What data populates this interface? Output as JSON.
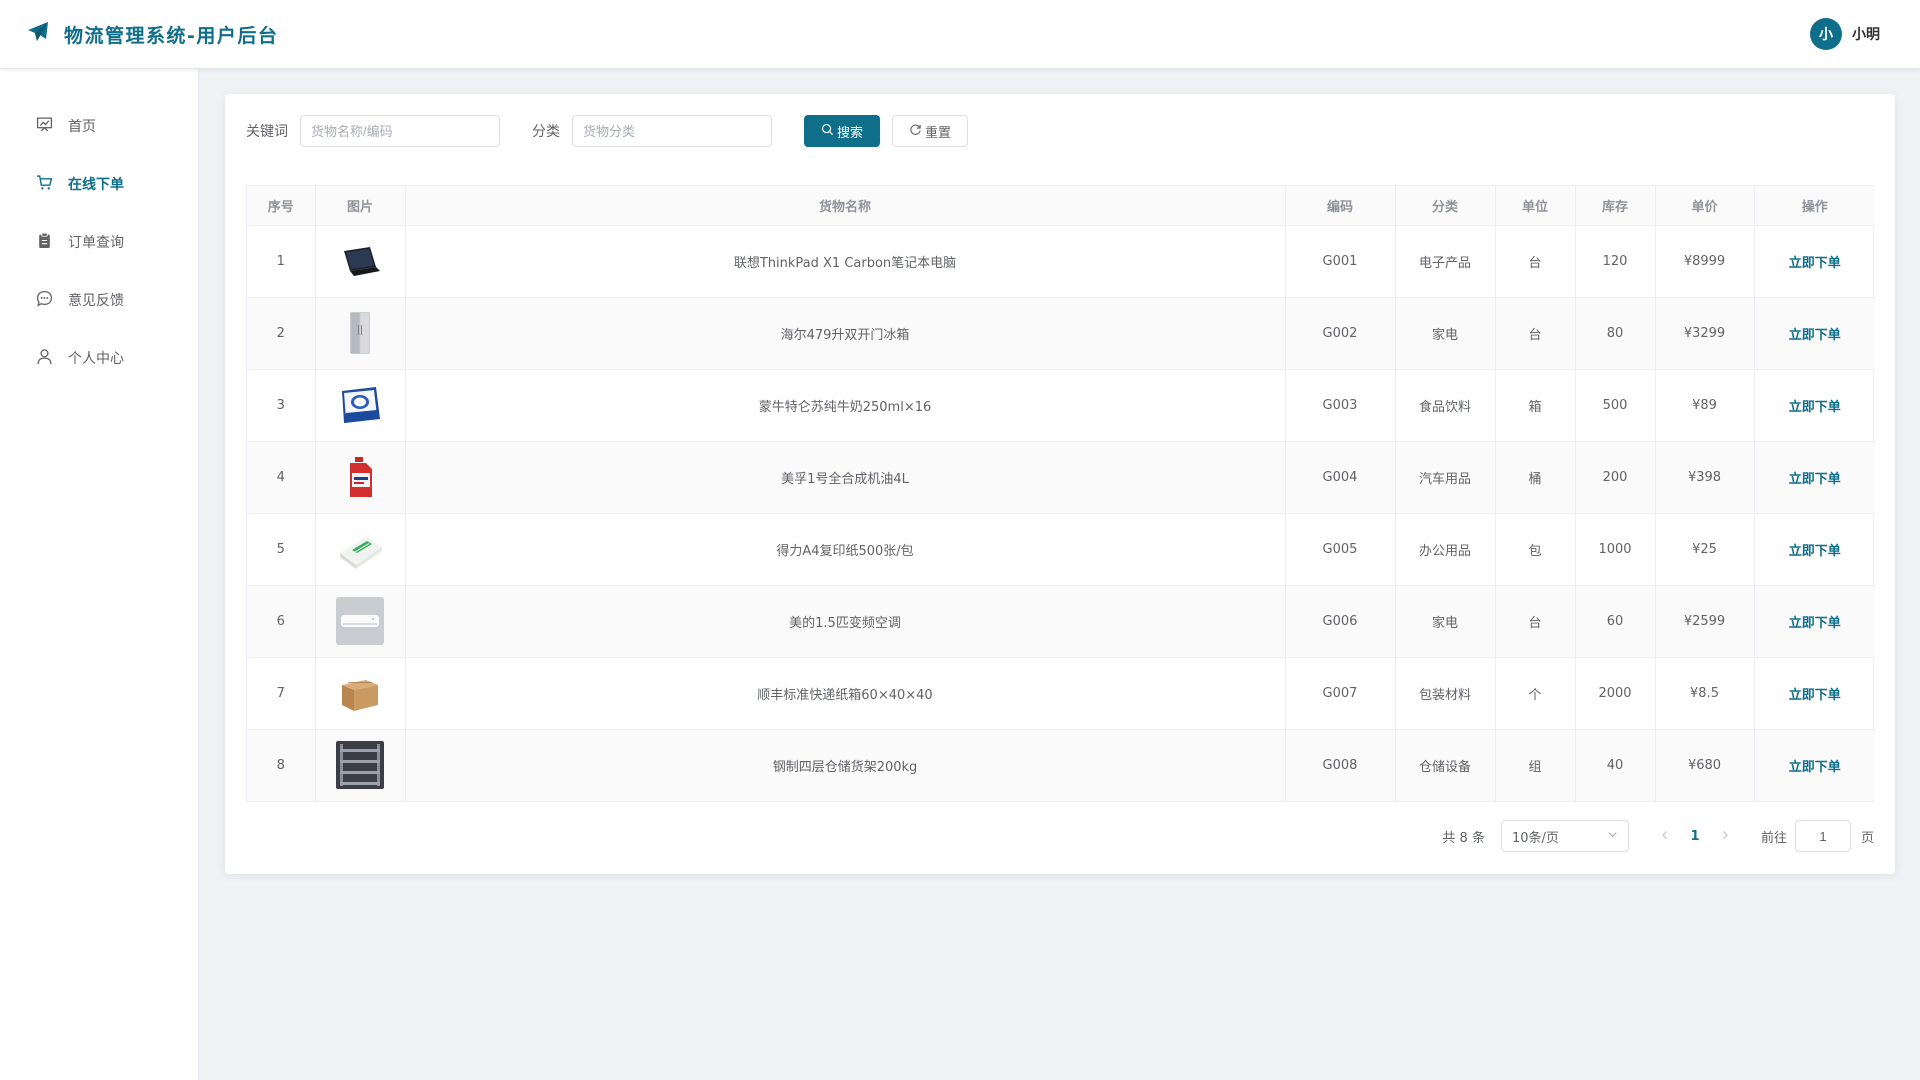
{
  "header": {
    "app_title": "物流管理系统-用户后台",
    "brand_color": "#0f6e8a",
    "logo_icon": "paper-plane-icon",
    "user": {
      "avatar_text": "小",
      "name": "小明"
    }
  },
  "sidebar": {
    "items": [
      {
        "label": "首页",
        "icon": "dashboard-icon",
        "active": false
      },
      {
        "label": "在线下单",
        "icon": "cart-icon",
        "active": true
      },
      {
        "label": "订单查询",
        "icon": "clipboard-icon",
        "active": false
      },
      {
        "label": "意见反馈",
        "icon": "chat-icon",
        "active": false
      },
      {
        "label": "个人中心",
        "icon": "user-icon",
        "active": false
      }
    ]
  },
  "search": {
    "keyword_label": "关键词",
    "keyword_placeholder": "货物名称/编码",
    "keyword_value": "",
    "category_label": "分类",
    "category_placeholder": "货物分类",
    "category_value": "",
    "search_button": "搜索",
    "reset_button": "重置"
  },
  "table": {
    "headers": [
      "序号",
      "图片",
      "货物名称",
      "编码",
      "分类",
      "单位",
      "库存",
      "单价",
      "操作"
    ],
    "action_label": "立即下单",
    "rows": [
      {
        "index": "1",
        "image": "laptop",
        "name": "联想ThinkPad X1 Carbon笔记本电脑",
        "code": "G001",
        "category": "电子产品",
        "unit": "台",
        "stock": "120",
        "price": "¥8999"
      },
      {
        "index": "2",
        "image": "fridge",
        "name": "海尔479升双开门冰箱",
        "code": "G002",
        "category": "家电",
        "unit": "台",
        "stock": "80",
        "price": "¥3299"
      },
      {
        "index": "3",
        "image": "milk",
        "name": "蒙牛特仑苏纯牛奶250ml×16",
        "code": "G003",
        "category": "食品饮料",
        "unit": "箱",
        "stock": "500",
        "price": "¥89"
      },
      {
        "index": "4",
        "image": "oil",
        "name": "美孚1号全合成机油4L",
        "code": "G004",
        "category": "汽车用品",
        "unit": "桶",
        "stock": "200",
        "price": "¥398"
      },
      {
        "index": "5",
        "image": "paper",
        "name": "得力A4复印纸500张/包",
        "code": "G005",
        "category": "办公用品",
        "unit": "包",
        "stock": "1000",
        "price": "¥25"
      },
      {
        "index": "6",
        "image": "aircon",
        "name": "美的1.5匹变频空调",
        "code": "G006",
        "category": "家电",
        "unit": "台",
        "stock": "60",
        "price": "¥2599"
      },
      {
        "index": "7",
        "image": "box",
        "name": "顺丰标准快递纸箱60×40×40",
        "code": "G007",
        "category": "包装材料",
        "unit": "个",
        "stock": "2000",
        "price": "¥8.5"
      },
      {
        "index": "8",
        "image": "shelf",
        "name": "钢制四层仓储货架200kg",
        "code": "G008",
        "category": "仓储设备",
        "unit": "组",
        "stock": "40",
        "price": "¥680"
      }
    ]
  },
  "pagination": {
    "total_text": "共 8 条",
    "page_size": "10条/页",
    "current_page": "1",
    "goto_label": "前往",
    "goto_value": "1",
    "page_suffix": "页"
  }
}
